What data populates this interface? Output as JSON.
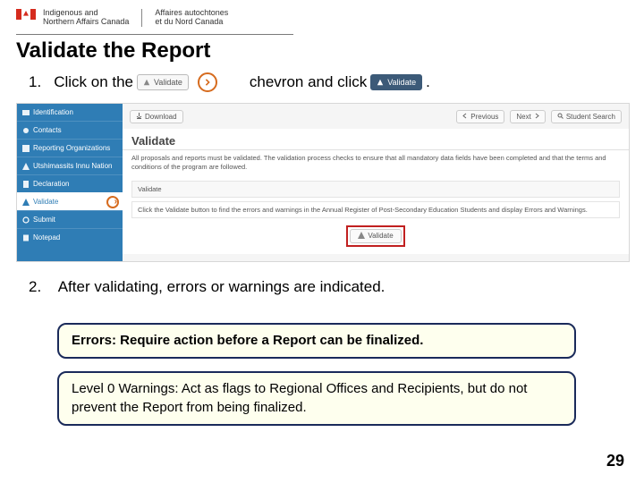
{
  "header": {
    "dept_en_1": "Indigenous and",
    "dept_en_2": "Northern Affairs Canada",
    "dept_fr_1": "Affaires autochtones",
    "dept_fr_2": "et du Nord Canada"
  },
  "title": "Validate the Report",
  "step1": {
    "num": "1.",
    "a": "Click on the",
    "chip_light": "Validate",
    "b": "chevron and click",
    "chip_dark": "Validate",
    "c": "."
  },
  "app": {
    "sidebar": [
      {
        "icon": "id-icon",
        "label": "Identification"
      },
      {
        "icon": "contacts-icon",
        "label": "Contacts"
      },
      {
        "icon": "org-icon",
        "label": "Reporting Organizations"
      },
      {
        "icon": "nation-icon",
        "label": "Utshimassits Innu Nation"
      },
      {
        "icon": "decl-icon",
        "label": "Declaration"
      },
      {
        "icon": "warn-icon",
        "label": "Validate",
        "active": true
      },
      {
        "icon": "submit-icon",
        "label": "Submit"
      },
      {
        "icon": "note-icon",
        "label": "Notepad"
      }
    ],
    "toolbar": {
      "download": "Download",
      "previous": "Previous",
      "next": "Next",
      "search": "Student Search"
    },
    "panel": {
      "title": "Validate",
      "desc": "All proposals and reports must be validated. The validation process checks to ensure that all mandatory data fields have been completed and that the terms and conditions of the program are followed.",
      "subheading": "Validate",
      "instruction": "Click the Validate button to find the errors and warnings in the Annual Register of Post-Secondary Education Students and display Errors and Warnings.",
      "button": "Validate"
    }
  },
  "step2": {
    "num": "2.",
    "text": "After validating, errors or warnings are indicated."
  },
  "callouts": {
    "errors": "Errors: Require action before a Report can be finalized.",
    "warnings": "Level 0 Warnings: Act as flags to Regional Offices and Recipients, but do not prevent the Report from being finalized."
  },
  "page_number": "29"
}
